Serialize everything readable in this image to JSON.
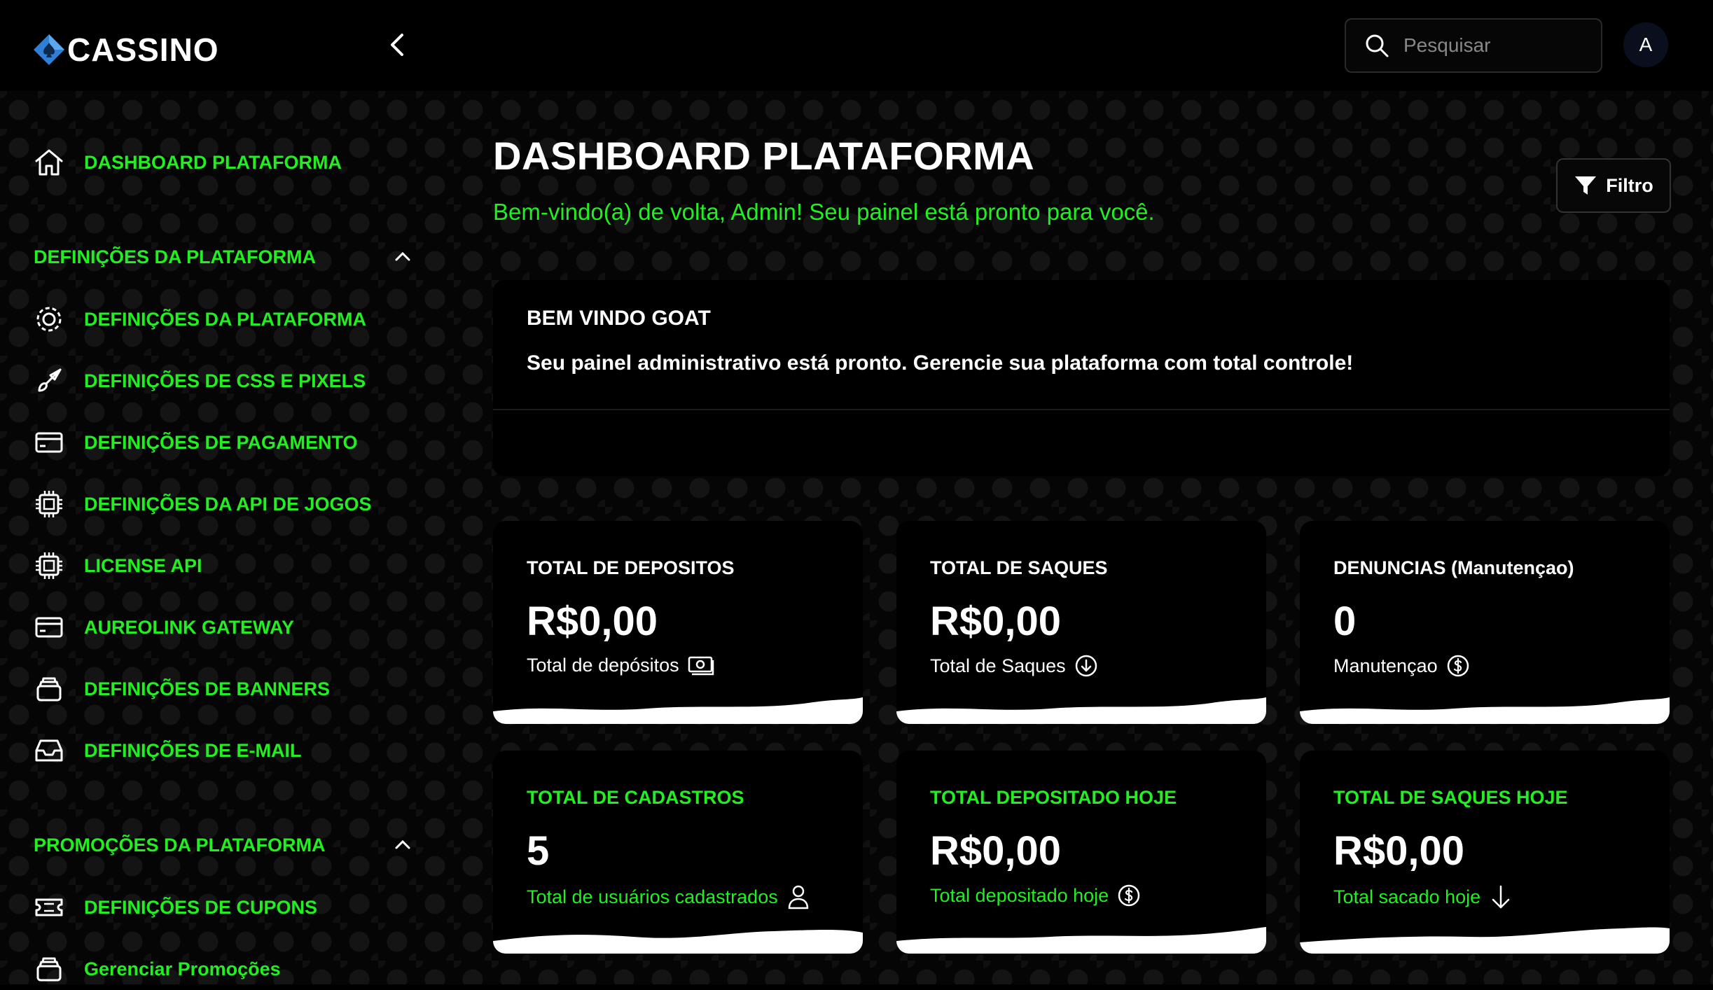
{
  "app": {
    "logo_text": "CASSINO",
    "search_placeholder": "Pesquisar",
    "avatar_initial": "A"
  },
  "sidebar": {
    "dashboard": "DASHBOARD PLATAFORMA",
    "section1": "DEFINIÇÕES DA PLATAFORMA",
    "items": [
      {
        "label": "DEFINIÇÕES DA PLATAFORMA",
        "icon": "gear-icon"
      },
      {
        "label": "DEFINIÇÕES DE CSS E PIXELS",
        "icon": "brush-icon"
      },
      {
        "label": "DEFINIÇÕES DE PAGAMENTO",
        "icon": "credit-card-icon"
      },
      {
        "label": "DEFINIÇÕES DA API DE JOGOS",
        "icon": "chip-icon"
      },
      {
        "label": "LICENSE API",
        "icon": "chip-icon"
      },
      {
        "label": "AUREOLINK GATEWAY",
        "icon": "credit-card-icon"
      },
      {
        "label": "DEFINIÇÕES DE BANNERS",
        "icon": "stack-icon"
      },
      {
        "label": "DEFINIÇÕES DE E-MAIL",
        "icon": "inbox-icon"
      }
    ],
    "section2": "PROMOÇÕES DA PLATAFORMA",
    "items2": [
      {
        "label": "DEFINIÇÕES DE CUPONS",
        "icon": "ticket-icon"
      },
      {
        "label": "Gerenciar Promoções",
        "icon": "stack-icon"
      }
    ]
  },
  "main": {
    "title": "DASHBOARD PLATAFORMA",
    "subtitle": "Bem-vindo(a) de volta, Admin! Seu painel está pronto para você.",
    "filter_label": "Filtro",
    "welcome_title": "BEM VINDO GOAT",
    "welcome_text": "Seu painel administrativo está pronto. Gerencie sua plataforma com total controle!"
  },
  "stats": [
    {
      "label": "TOTAL DE DEPOSITOS",
      "value": "R$0,00",
      "desc": "Total de depósitos",
      "icon": "money-icon"
    },
    {
      "label": "TOTAL DE SAQUES",
      "value": "R$0,00",
      "desc": "Total de Saques",
      "icon": "arrow-down-circle-icon"
    },
    {
      "label": "DENUNCIAS (Manutençao)",
      "value": "0",
      "desc": "Manutençao",
      "icon": "dollar-circle-icon"
    },
    {
      "label": "TOTAL DE CADASTROS",
      "value": "5",
      "desc": "Total de usuários cadastrados",
      "icon": "user-icon"
    },
    {
      "label": "TOTAL DEPOSITADO HOJE",
      "value": "R$0,00",
      "desc": "Total depositado hoje",
      "icon": "dollar-circle-icon"
    },
    {
      "label": "TOTAL DE SAQUES HOJE",
      "value": "R$0,00",
      "desc": "Total sacado hoje",
      "icon": "arrow-down-icon"
    }
  ],
  "colors": {
    "accent": "#22ee22",
    "background": "#000000",
    "logo_blue": "#2f7fd6"
  }
}
